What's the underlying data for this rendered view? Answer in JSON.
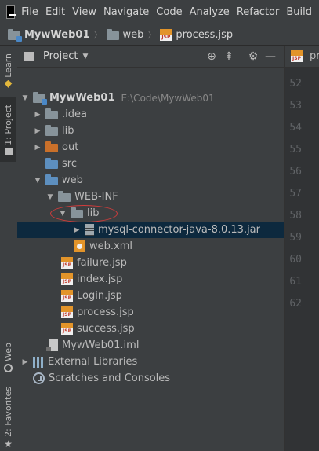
{
  "colors": {
    "background": "#3c3f41",
    "selection": "#0d293e",
    "editor_bg": "#2b2b2b",
    "highlight": "#d23c3c",
    "jsp_orange": "#e2942a",
    "excluded_folder": "#c9702a",
    "source_folder": "#5d8fbf"
  },
  "menubar": {
    "logo": "IJ",
    "items": [
      "File",
      "Edit",
      "View",
      "Navigate",
      "Code",
      "Analyze",
      "Refactor",
      "Build"
    ]
  },
  "breadcrumb": {
    "project": "MywWeb01",
    "folder": "web",
    "file": "process.jsp"
  },
  "left_strip": {
    "learn": "Learn",
    "project": "1: Project",
    "web": "Web",
    "favorites": "2: Favorites"
  },
  "panel": {
    "title": "Project",
    "icons": [
      "target-icon",
      "collapse-all-icon",
      "gear-icon",
      "minimize-icon"
    ]
  },
  "tree": {
    "root": {
      "label": "MywWeb01",
      "path": "E:\\Code\\MywWeb01"
    },
    "idea": ".idea",
    "lib": "lib",
    "out": "out",
    "src": "src",
    "web": "web",
    "webinf": "WEB-INF",
    "webinf_lib": "lib",
    "jar": "mysql-connector-java-8.0.13.jar",
    "webxml": "web.xml",
    "failure": "failure.jsp",
    "index": "index.jsp",
    "login": "Login.jsp",
    "process": "process.jsp",
    "success": "success.jsp",
    "iml": "MywWeb01.iml",
    "external": "External Libraries",
    "scratches": "Scratches and Consoles"
  },
  "icon_text": {
    "jsp": "JSP"
  },
  "editor": {
    "tab_label": "pro",
    "line_numbers": [
      "52",
      "53",
      "54",
      "55",
      "56",
      "57",
      "58",
      "59",
      "60",
      "61",
      "62"
    ]
  }
}
